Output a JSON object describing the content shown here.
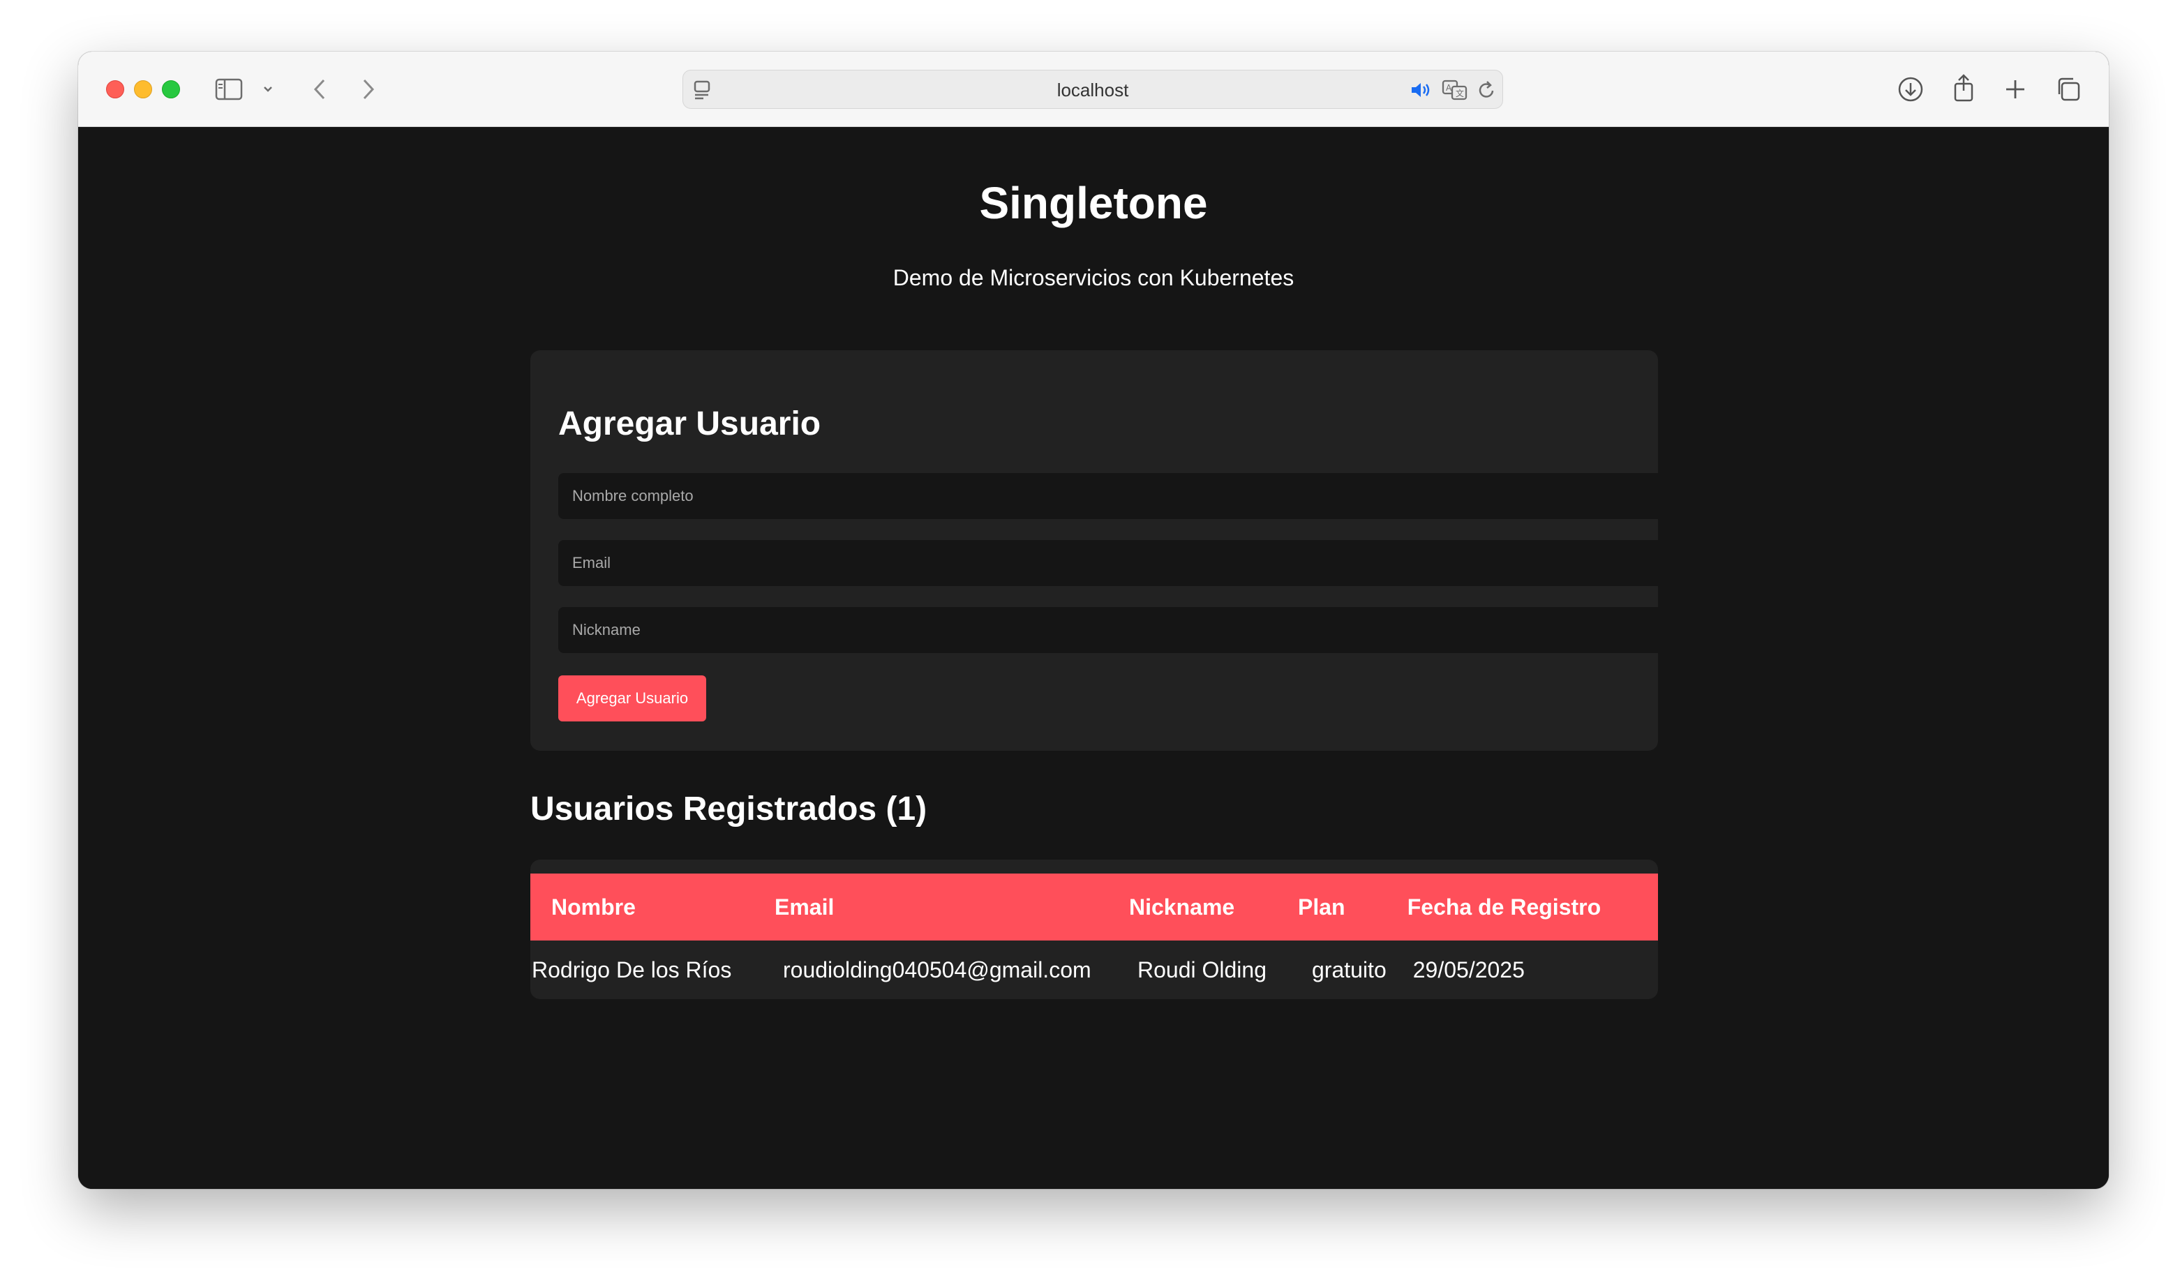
{
  "browser": {
    "url": "localhost"
  },
  "header": {
    "title": "Singletone",
    "subtitle": "Demo de Microservicios con Kubernetes"
  },
  "form": {
    "title": "Agregar Usuario",
    "name_placeholder": "Nombre completo",
    "email_placeholder": "Email",
    "nickname_placeholder": "Nickname",
    "submit_label": "Agregar Usuario"
  },
  "users": {
    "title": "Usuarios Registrados (1)",
    "columns": [
      "Nombre",
      "Email",
      "Nickname",
      "Plan",
      "Fecha de Registro"
    ],
    "rows": [
      {
        "name": "Rodrigo De los Ríos",
        "email": "roudiolding040504@gmail.com",
        "nickname": "Roudi Olding",
        "plan": "gratuito",
        "date": "29/05/2025"
      }
    ]
  },
  "colors": {
    "accent": "#ff4f5a",
    "background": "#151515",
    "card": "#222222"
  }
}
